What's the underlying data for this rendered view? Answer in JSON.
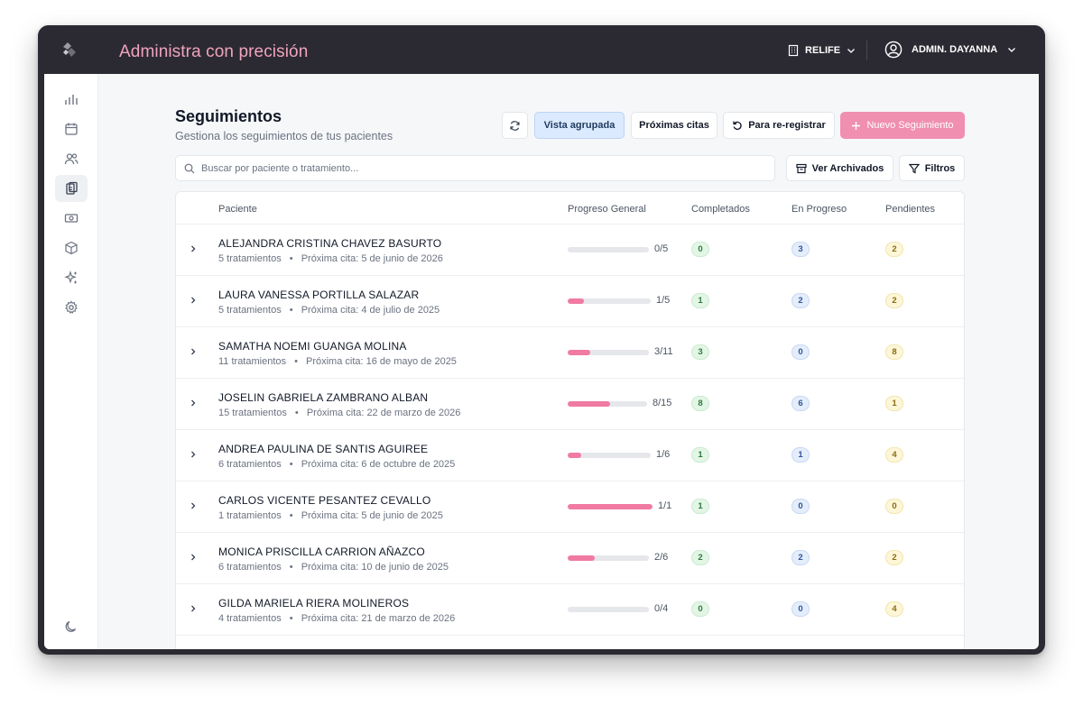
{
  "header": {
    "app_title": "Administra con precisión",
    "organization": "RELIFE",
    "user": "ADMIN. DAYANNA"
  },
  "sidebar": {
    "items": [
      {
        "icon": "bar-chart-icon",
        "active": false
      },
      {
        "icon": "calendar-icon",
        "active": false
      },
      {
        "icon": "users-icon",
        "active": false
      },
      {
        "icon": "clipboard-icon",
        "active": true
      },
      {
        "icon": "money-icon",
        "active": false
      },
      {
        "icon": "box-icon",
        "active": false
      },
      {
        "icon": "sparkles-icon",
        "active": false
      },
      {
        "icon": "gear-icon",
        "active": false
      }
    ],
    "bottom_icon": "moon-icon"
  },
  "page": {
    "title": "Seguimientos",
    "subtitle": "Gestiona los seguimientos de tus pacientes"
  },
  "toolbar": {
    "refresh_icon": "refresh-icon",
    "grouped_view": "Vista agrupada",
    "upcoming": "Próximas citas",
    "reregister": "Para re-registrar",
    "new_followup": "Nuevo Seguimiento",
    "archived": "Ver Archivados",
    "filters": "Filtros"
  },
  "search": {
    "placeholder": "Buscar por paciente o tratamiento...",
    "value": ""
  },
  "table": {
    "columns": {
      "patient": "Paciente",
      "progress": "Progreso General",
      "completed": "Completados",
      "in_progress": "En Progreso",
      "pending": "Pendientes"
    },
    "rows": [
      {
        "name": "ALEJANDRA CRISTINA CHAVEZ BASURTO",
        "treatments": "5 tratamientos",
        "next": "Próxima cita: 5 de junio de 2026",
        "ratio": "0/5",
        "progress": 0.0,
        "completed": "0",
        "in_progress": "3",
        "pending": "2"
      },
      {
        "name": "LAURA VANESSA PORTILLA SALAZAR",
        "treatments": "5 tratamientos",
        "next": "Próxima cita: 4 de julio de 2025",
        "ratio": "1/5",
        "progress": 0.2,
        "completed": "1",
        "in_progress": "2",
        "pending": "2"
      },
      {
        "name": "SAMATHA NOEMI GUANGA MOLINA",
        "treatments": "11 tratamientos",
        "next": "Próxima cita: 16 de mayo de 2025",
        "ratio": "3/11",
        "progress": 0.273,
        "completed": "3",
        "in_progress": "0",
        "pending": "8"
      },
      {
        "name": "JOSELIN GABRIELA ZAMBRANO ALBAN",
        "treatments": "15 tratamientos",
        "next": "Próxima cita: 22 de marzo de 2026",
        "ratio": "8/15",
        "progress": 0.533,
        "completed": "8",
        "in_progress": "6",
        "pending": "1"
      },
      {
        "name": "ANDREA PAULINA DE SANTIS AGUIREE",
        "treatments": "6 tratamientos",
        "next": "Próxima cita: 6 de octubre de 2025",
        "ratio": "1/6",
        "progress": 0.167,
        "completed": "1",
        "in_progress": "1",
        "pending": "4"
      },
      {
        "name": "CARLOS VICENTE PESANTEZ CEVALLO",
        "treatments": "1 tratamientos",
        "next": "Próxima cita: 5 de junio de 2025",
        "ratio": "1/1",
        "progress": 1.0,
        "completed": "1",
        "in_progress": "0",
        "pending": "0"
      },
      {
        "name": "MONICA PRISCILLA CARRION AÑAZCO",
        "treatments": "6 tratamientos",
        "next": "Próxima cita: 10 de junio de 2025",
        "ratio": "2/6",
        "progress": 0.333,
        "completed": "2",
        "in_progress": "2",
        "pending": "2"
      },
      {
        "name": "GILDA MARIELA RIERA MOLINEROS",
        "treatments": "4 tratamientos",
        "next": "Próxima cita: 21 de marzo de 2026",
        "ratio": "0/4",
        "progress": 0.0,
        "completed": "0",
        "in_progress": "0",
        "pending": "4"
      }
    ]
  },
  "colors": {
    "topbar": "#2b2a33",
    "accent_pink": "#f07aa2",
    "title_pink": "#f0a3bb",
    "grouped_view_bg": "#dbeafe"
  }
}
